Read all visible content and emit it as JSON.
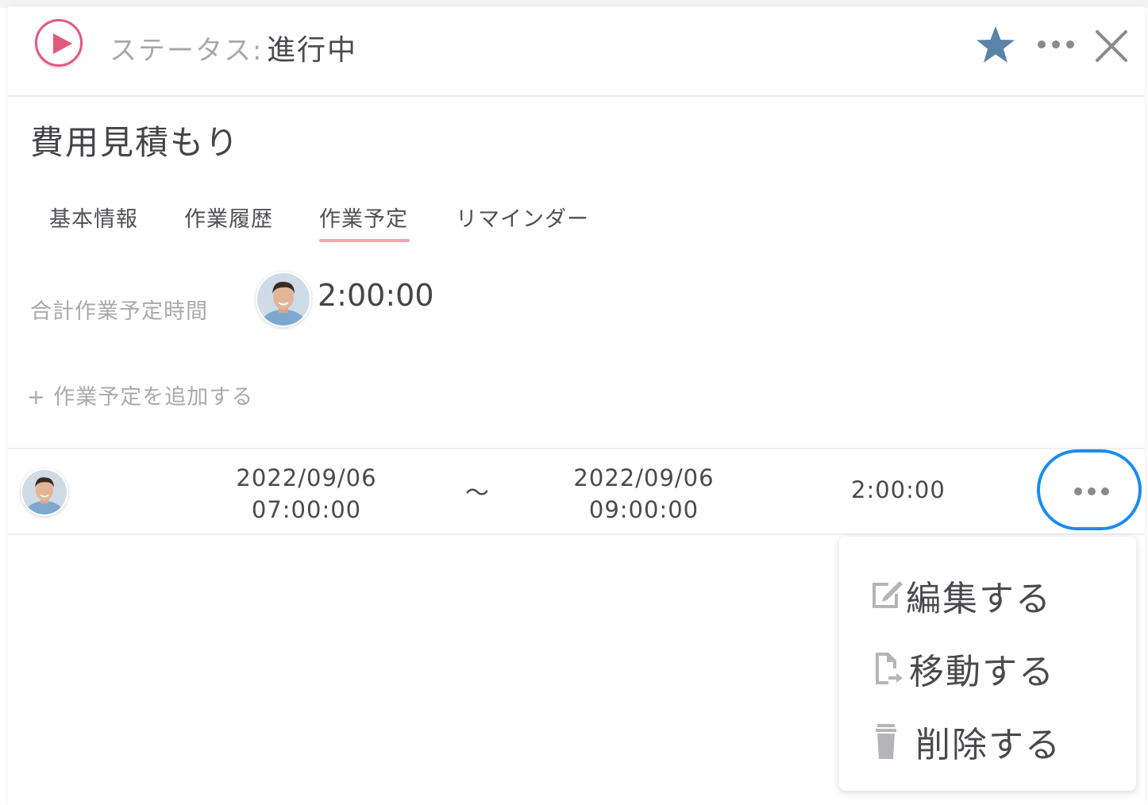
{
  "header": {
    "status_label": "ステータス:",
    "status_value": "進行中",
    "icons": [
      "play-icon",
      "star-icon",
      "more-icon",
      "close-icon"
    ]
  },
  "task": {
    "title": "費用見積もり"
  },
  "tabs": [
    {
      "label": "基本情報",
      "active": false
    },
    {
      "label": "作業履歴",
      "active": false
    },
    {
      "label": "作業予定",
      "active": true
    },
    {
      "label": "リマインダー",
      "active": false
    }
  ],
  "summary": {
    "total_label": "合計作業予定時間",
    "total_value": "2:00:00"
  },
  "add_link": "+ 作業予定を追加する",
  "schedule_rows": [
    {
      "start_date": "2022/09/06",
      "start_time": "07:00:00",
      "separator": "〜",
      "end_date": "2022/09/06",
      "end_time": "09:00:00",
      "duration": "2:00:00"
    }
  ],
  "context_menu": {
    "items": [
      {
        "label": "編集する",
        "icon": "edit-icon"
      },
      {
        "label": "移動する",
        "icon": "move-icon"
      },
      {
        "label": "削除する",
        "icon": "trash-icon"
      }
    ]
  },
  "colors": {
    "play_accent": "#e05a7e",
    "star": "#5b82a8",
    "tab_underline": "#f2a6ad",
    "focus_ring": "#1a8cf0"
  }
}
